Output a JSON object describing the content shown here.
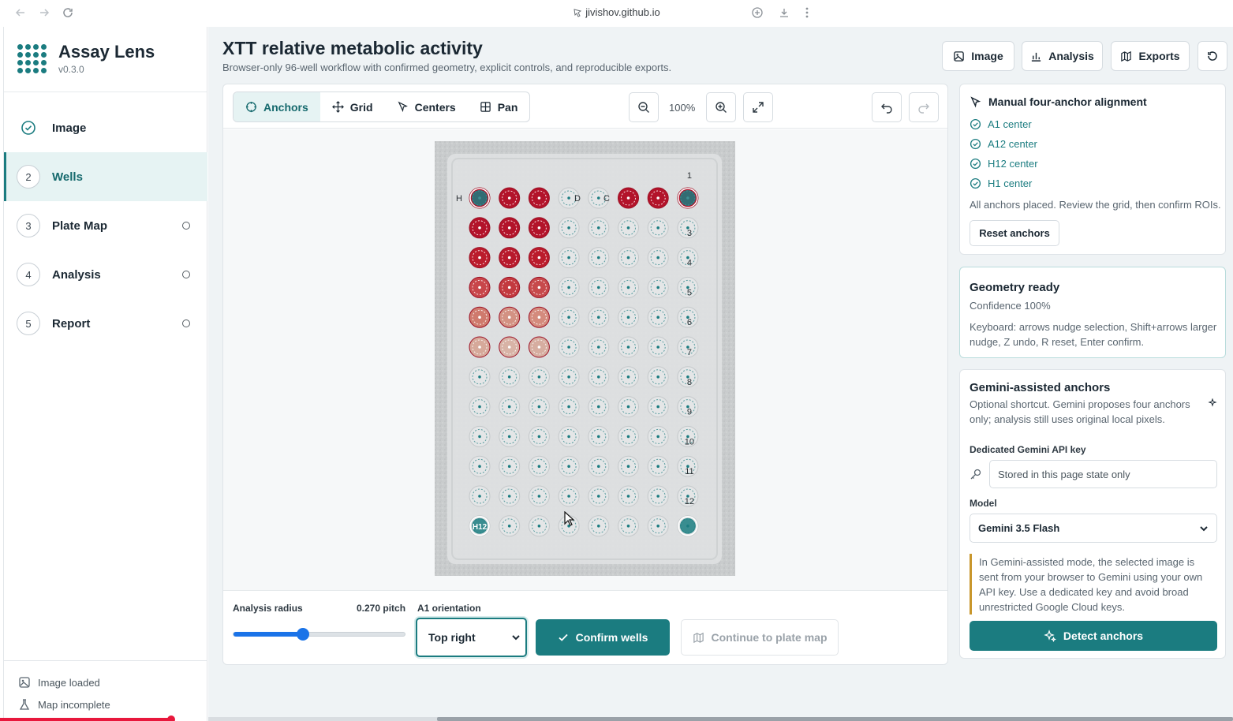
{
  "browser": {
    "url": "jivishov.github.io"
  },
  "app": {
    "name": "Assay Lens",
    "version": "v0.3.0"
  },
  "steps": [
    {
      "num": "",
      "label": "Image",
      "state": "done"
    },
    {
      "num": "2",
      "label": "Wells",
      "state": "active"
    },
    {
      "num": "3",
      "label": "Plate Map",
      "state": "pending"
    },
    {
      "num": "4",
      "label": "Analysis",
      "state": "pending"
    },
    {
      "num": "5",
      "label": "Report",
      "state": "pending"
    }
  ],
  "sidebar_status": {
    "image": "Image loaded",
    "map": "Map incomplete"
  },
  "header": {
    "title": "XTT relative metabolic activity",
    "subtitle": "Browser-only 96-well workflow with confirmed geometry, explicit controls, and reproducible exports.",
    "buttons": {
      "image": "Image",
      "analysis": "Analysis",
      "exports": "Exports"
    }
  },
  "toolbar": {
    "modes": [
      "Anchors",
      "Grid",
      "Centers",
      "Pan"
    ],
    "active_mode": "Anchors",
    "zoom": "100%"
  },
  "plate": {
    "row_letters": [
      "H",
      "D",
      "C"
    ],
    "column_numbers": [
      "1",
      "3",
      "4",
      "5",
      "6",
      "7",
      "8",
      "9",
      "10",
      "11",
      "12"
    ],
    "anchor_labels": [
      "H12"
    ],
    "accent": "#1b7c80"
  },
  "controls": {
    "radius_label": "Analysis radius",
    "radius_value": "0.270 pitch",
    "radius_fraction": 0.4,
    "orientation_label": "A1 orientation",
    "orientation_value": "Top right",
    "confirm": "Confirm wells",
    "continue": "Continue to plate map"
  },
  "anchors_card": {
    "title": "Manual four-anchor alignment",
    "items": [
      "A1 center",
      "A12 center",
      "H12 center",
      "H1 center"
    ],
    "status": "All anchors placed. Review the grid, then confirm ROIs.",
    "reset": "Reset anchors"
  },
  "geometry_card": {
    "title": "Geometry ready",
    "confidence": "Confidence 100%",
    "hint": "Keyboard: arrows nudge selection, Shift+arrows larger nudge, Z undo, R reset, Enter confirm."
  },
  "gemini_card": {
    "title": "Gemini-assisted anchors",
    "desc": "Optional shortcut. Gemini proposes four anchors only; analysis still uses original local pixels.",
    "key_label": "Dedicated Gemini API key",
    "key_placeholder": "Stored in this page state only",
    "model_label": "Model",
    "model_value": "Gemini 3.5 Flash",
    "note": "In Gemini-assisted mode, the selected image is sent from your browser to Gemini using your own API key. Use a dedicated key and avoid broad unrestricted Google Cloud keys.",
    "detect": "Detect anchors"
  }
}
